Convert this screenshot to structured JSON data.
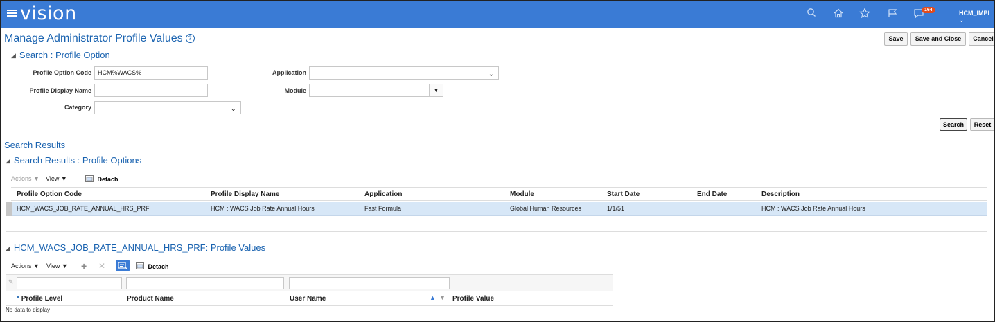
{
  "app": {
    "brand": "vision",
    "notification_count": "164",
    "user": "HCM_IMPL"
  },
  "icons": [
    "menu-icon",
    "search-icon",
    "home-icon",
    "star-icon",
    "flag-icon",
    "notification-icon",
    "chevron-down-icon",
    "help-icon",
    "settings-icon",
    "detach-icon",
    "add-icon",
    "delete-icon",
    "query-by-example-icon",
    "sort-ascending-icon",
    "sort-descending-icon",
    "edit-icon"
  ],
  "page": {
    "title": "Manage Administrator Profile Values",
    "save_label": "Save",
    "save_close_label": "Save and Close",
    "cancel_label": "Cancel"
  },
  "search": {
    "section_title": "Search : Profile Option",
    "profile_option_code_label": "Profile Option Code",
    "profile_option_code_value": "HCM%WACS%",
    "profile_display_name_label": "Profile Display Name",
    "profile_display_name_value": "",
    "category_label": "Category",
    "category_value": "",
    "application_label": "Application",
    "application_value": "",
    "module_label": "Module",
    "module_value": "",
    "search_label": "Search",
    "reset_label": "Reset"
  },
  "results": {
    "title": "Search Results",
    "section_title": "Search Results : Profile Options",
    "toolbar": {
      "actions": "Actions",
      "view": "View",
      "detach": "Detach"
    },
    "columns": [
      "Profile Option Code",
      "Profile Display Name",
      "Application",
      "Module",
      "Start Date",
      "End Date",
      "Description"
    ],
    "rows": [
      {
        "code": "HCM_WACS_JOB_RATE_ANNUAL_HRS_PRF",
        "display_name": "HCM : WACS Job Rate Annual Hours",
        "application": "Fast Formula",
        "module": "Global Human Resources",
        "start_date": "1/1/51",
        "end_date": "",
        "description": "HCM : WACS Job Rate Annual Hours"
      }
    ]
  },
  "values": {
    "section_title": "HCM_WACS_JOB_RATE_ANNUAL_HRS_PRF: Profile Values",
    "toolbar": {
      "actions": "Actions",
      "view": "View",
      "detach": "Detach"
    },
    "columns": {
      "profile_level": "Profile Level",
      "product_name": "Product Name",
      "user_name": "User Name",
      "profile_value": "Profile Value"
    },
    "required_marker": "*",
    "empty_text": "No data to display"
  }
}
